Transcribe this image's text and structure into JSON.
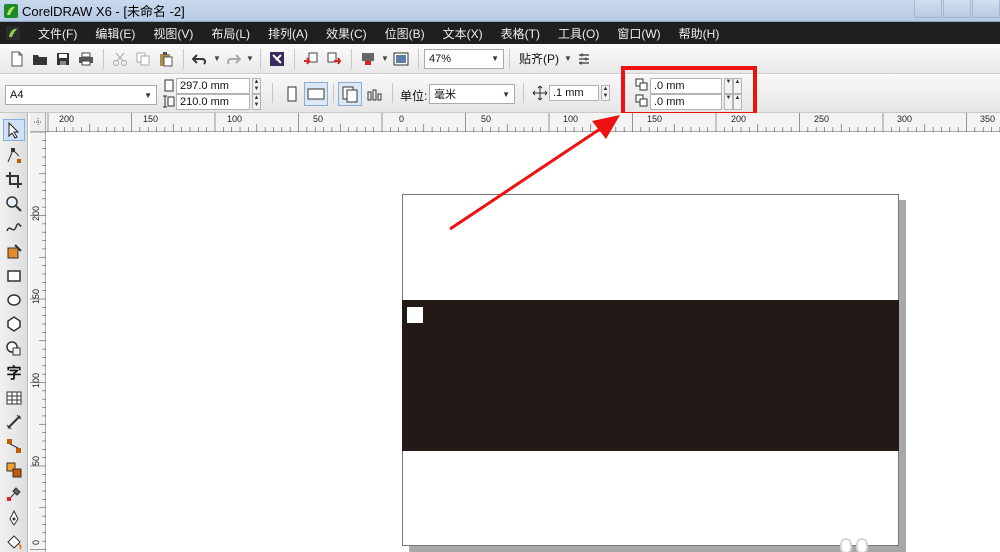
{
  "window": {
    "title": "CorelDRAW X6 - [未命名 -2]"
  },
  "menu": {
    "items": [
      "文件(F)",
      "编辑(E)",
      "视图(V)",
      "布局(L)",
      "排列(A)",
      "效果(C)",
      "位图(B)",
      "文本(X)",
      "表格(T)",
      "工具(O)",
      "窗口(W)",
      "帮助(H)"
    ]
  },
  "toolbar": {
    "zoom": "47%",
    "snap_label": "贴齐(P)"
  },
  "property_bar": {
    "paper_size": "A4",
    "width": "297.0 mm",
    "height": "210.0 mm",
    "units_label": "单位:",
    "units_value": "毫米",
    "nudge": ".1 mm",
    "dup_x": ".0 mm",
    "dup_y": ".0 mm"
  },
  "ruler": {
    "h_labels": [
      "200",
      "150",
      "100",
      "50",
      "0",
      "50",
      "100",
      "150",
      "200",
      "250",
      "300",
      "350"
    ],
    "v_labels": [
      "200",
      "150",
      "100",
      "50",
      "0"
    ]
  },
  "toolbox": {
    "text_tool_glyph": "字"
  },
  "colors": {
    "accent_highlight": "#ee1111",
    "arrow": "#ee1111",
    "band": "#231a17",
    "menubar": "#1f1f1f"
  }
}
